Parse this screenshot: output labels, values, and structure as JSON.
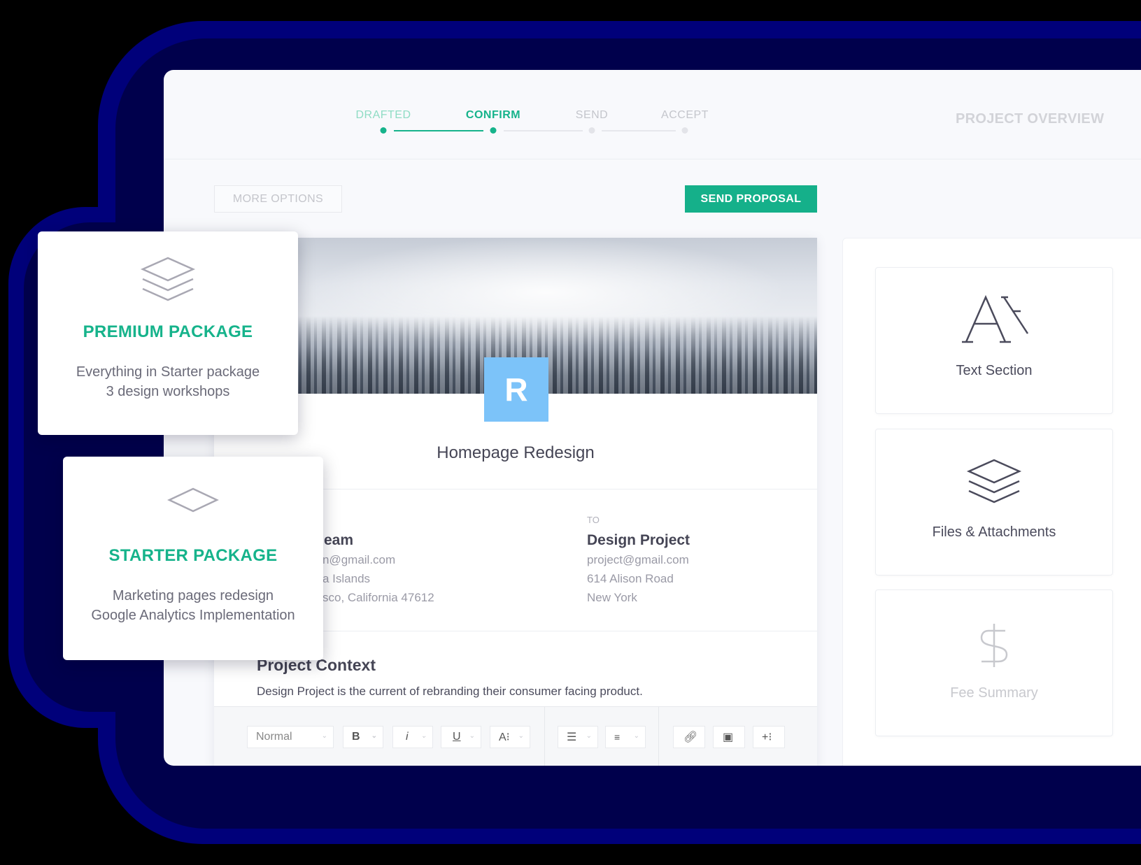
{
  "colors": {
    "accent": "#16b38b",
    "logo": "#7cc3f9",
    "background_band": "#00007a"
  },
  "steps": [
    {
      "label": "DRAFTED",
      "state": "done"
    },
    {
      "label": "CONFIRM",
      "state": "active"
    },
    {
      "label": "SEND",
      "state": "pending"
    },
    {
      "label": "ACCEPT",
      "state": "pending"
    }
  ],
  "header": {
    "project_overview": "PROJECT OVERVIEW"
  },
  "actions": {
    "more_options": "MORE OPTIONS",
    "send_proposal": "SEND PROPOSAL"
  },
  "document": {
    "logo_letter": "R",
    "title": "Homepage Redesign",
    "from": {
      "name": "eam",
      "email": "n@gmail.com",
      "address1": "a Islands",
      "address2": "sco, California  47612"
    },
    "to": {
      "label": "TO",
      "name": "Design Project",
      "email": "project@gmail.com",
      "address1": "614 Alison Road",
      "address2": "New York"
    },
    "context_title": "Project Context",
    "context_text": "Design Project is the current of rebranding their consumer facing product."
  },
  "toolbar": {
    "style": "Normal",
    "bold": "B",
    "italic": "i",
    "underline": "U",
    "font_size": "A⁝",
    "insert": "+⁝"
  },
  "blocks": [
    {
      "label": "Text Section",
      "icon": "text-icon"
    },
    {
      "label": "Files & Attachments",
      "icon": "layers-icon"
    },
    {
      "label": "Fee Summary",
      "icon": "dollar-icon",
      "disabled": true
    }
  ],
  "packages": [
    {
      "title": "PREMIUM PACKAGE",
      "lines": [
        "Everything in Starter package",
        "3 design workshops"
      ],
      "icon": "layers-icon"
    },
    {
      "title": "STARTER PACKAGE",
      "lines": [
        "Marketing pages redesign",
        "Google Analytics Implementation"
      ],
      "icon": "diamond-icon"
    }
  ]
}
